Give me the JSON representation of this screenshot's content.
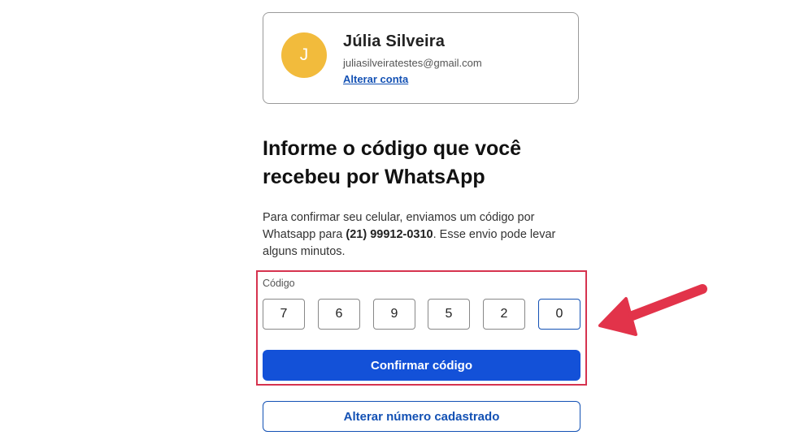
{
  "account": {
    "avatar_initial": "J",
    "name": "Júlia Silveira",
    "email": "juliasilveiratestes@gmail.com",
    "change_account_link": "Alterar conta"
  },
  "heading": "Informe o código que você recebeu por WhatsApp",
  "description": {
    "before": "Para confirmar seu celular, enviamos um código por Whatsapp para ",
    "phone": "(21) 99912-0310",
    "after": ". Esse envio pode levar alguns minutos."
  },
  "code": {
    "label": "Código",
    "digits": [
      "7",
      "6",
      "9",
      "5",
      "2",
      "0"
    ]
  },
  "buttons": {
    "confirm": "Confirmar código",
    "change_number": "Alterar número cadastrado"
  },
  "colors": {
    "primary": "#1351d8",
    "link": "#1351b4",
    "avatar": "#f2bb3c",
    "annotation": "#d6334f"
  },
  "annotation": {
    "arrow_icon": "red-arrow-icon"
  }
}
